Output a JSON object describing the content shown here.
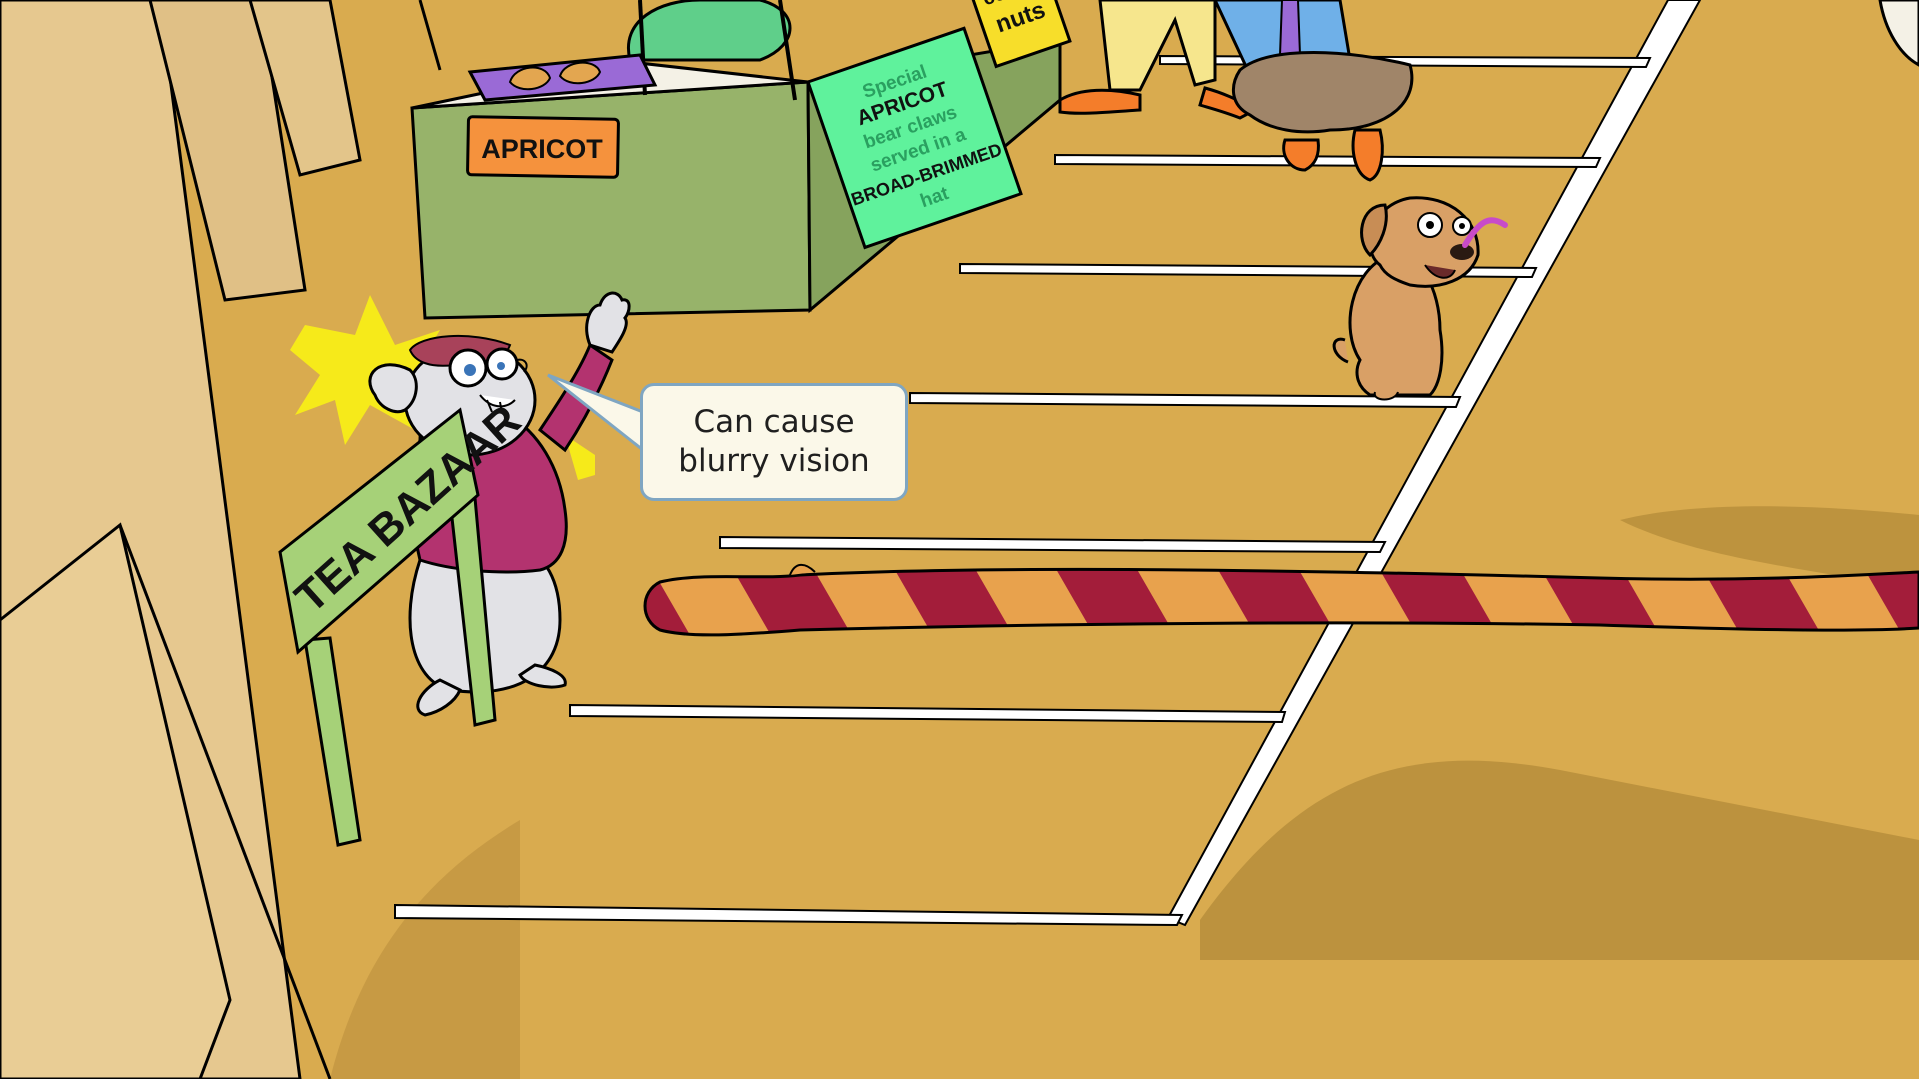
{
  "scene": {
    "speech_bubble": {
      "line1": "Can cause",
      "line2": "blurry vision"
    },
    "signs": {
      "tea_bazaar": "TEA BAZAAR",
      "apricot": "APRICOT",
      "stall_board": [
        "Special",
        "APRICOT",
        "bear claws",
        "served in a",
        "BROAD-BRIMMED",
        "hat"
      ],
      "nuts_sign": [
        "coffee",
        "nuts"
      ]
    },
    "colors": {
      "floor": "#d9ab4f",
      "wall": "#e6c88f",
      "stall_green": "#97b36a",
      "board_green": "#5ff29c",
      "sign_green": "#a6d178",
      "barrier_red": "#a31d3a",
      "barrier_orange": "#e8a24d",
      "mouse_shirt": "#b3336f",
      "dog": "#d9a066",
      "bubble_border": "#7fa6c2"
    }
  }
}
